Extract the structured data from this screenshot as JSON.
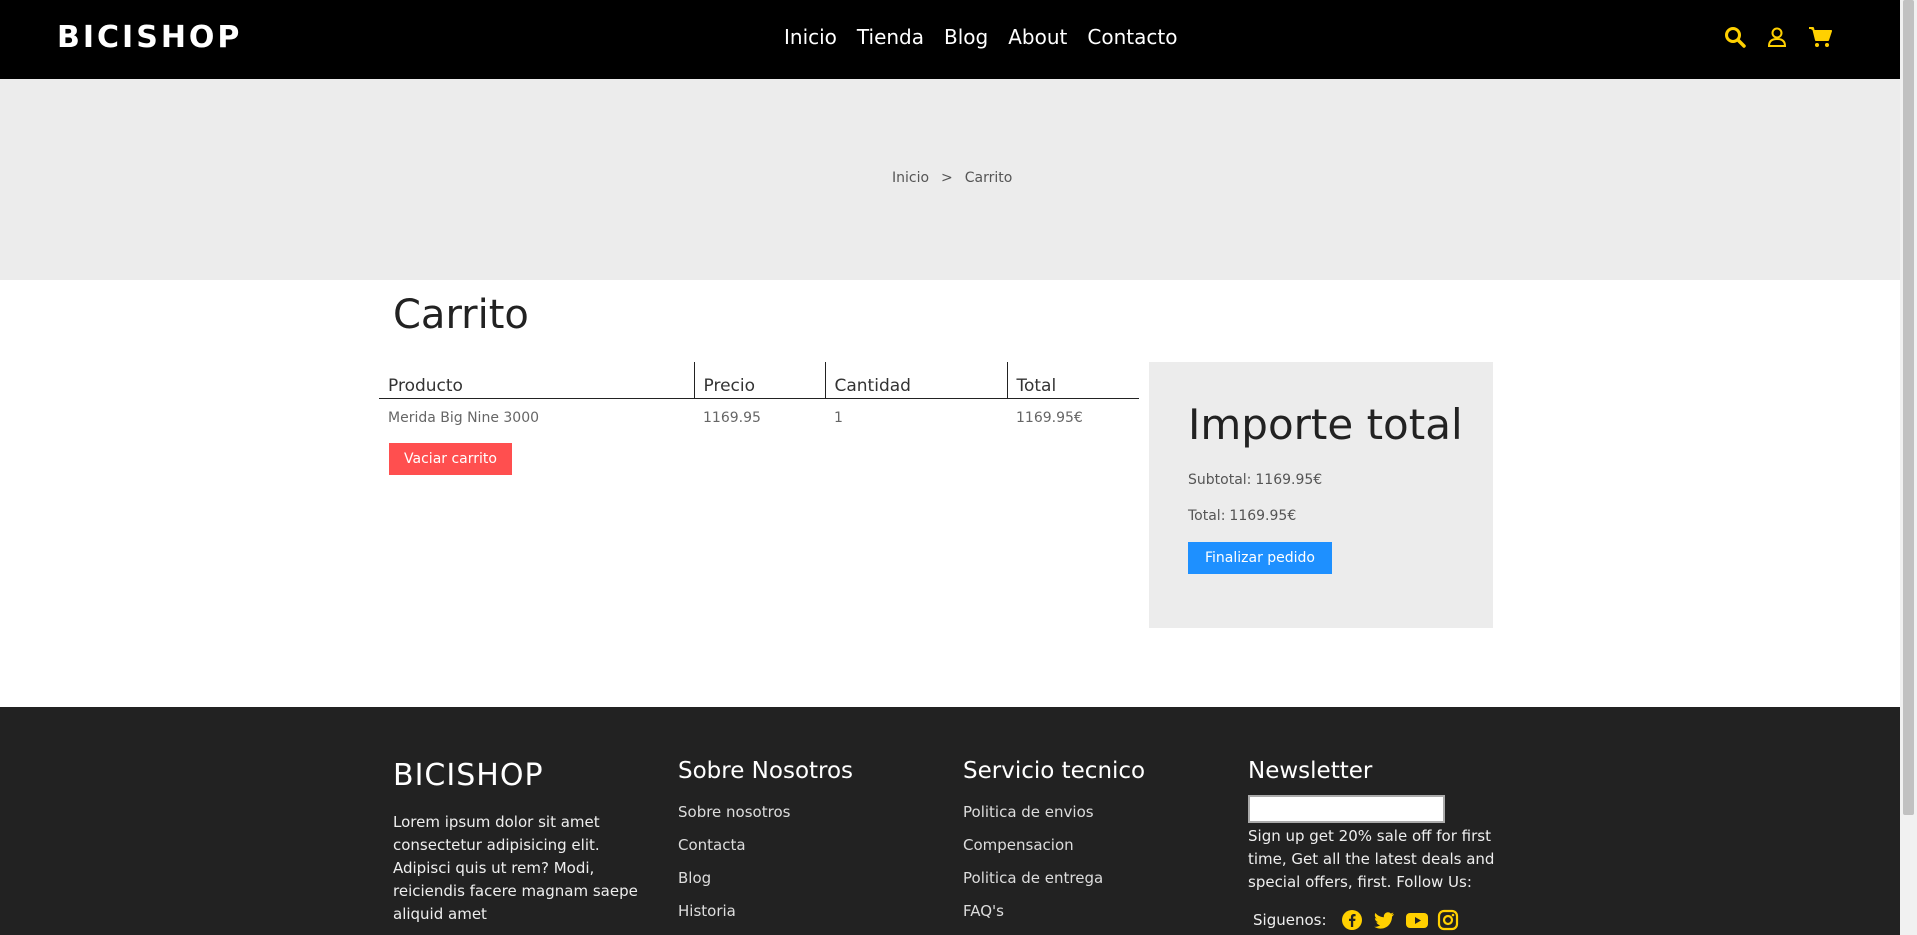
{
  "header": {
    "brand": "BICISHOP",
    "nav": [
      "Inicio",
      "Tienda",
      "Blog",
      "About",
      "Contacto"
    ],
    "icons": [
      "search-icon",
      "user-icon",
      "cart-icon"
    ],
    "accent_color": "#ffd000"
  },
  "breadcrumb": {
    "home": "Inicio",
    "separator": ">",
    "current": "Carrito"
  },
  "cart": {
    "title": "Carrito",
    "columns": [
      "Producto",
      "Precio",
      "Cantidad",
      "Total"
    ],
    "rows": [
      {
        "product": "Merida Big Nine 3000",
        "price": "1169.95",
        "quantity": "1",
        "total": "1169.95€"
      }
    ],
    "empty_button": "Vaciar carrito"
  },
  "summary": {
    "title": "Importe total",
    "subtotal_label": "Subtotal:",
    "subtotal_value": "1169.95€",
    "total_label": "Total:",
    "total_value": "1169.95€",
    "checkout_button": "Finalizar pedido"
  },
  "footer": {
    "brand": "BICISHOP",
    "description": "Lorem ipsum dolor sit amet consectetur adipisicing elit. Adipisci quis ut rem? Modi, reiciendis facere magnam saepe aliquid amet",
    "about": {
      "title": "Sobre Nosotros",
      "links": [
        "Sobre nosotros",
        "Contacta",
        "Blog",
        "Historia"
      ]
    },
    "service": {
      "title": "Servicio tecnico",
      "links": [
        "Politica de envios",
        "Compensacion",
        "Politica de entrega",
        "FAQ's"
      ]
    },
    "newsletter": {
      "title": "Newsletter",
      "input_value": "",
      "text": "Sign up get 20% sale off for first time, Get all the latest deals and special offers, first. Follow Us:",
      "follow_label": "Siguenos:",
      "social_icons": [
        "facebook-icon",
        "twitter-icon",
        "youtube-icon",
        "instagram-icon"
      ]
    }
  },
  "colors": {
    "danger_button": "#ff4f4f",
    "primary_button": "#1e90ff",
    "footer_bg": "#222222",
    "banner_bg": "#ececec"
  }
}
